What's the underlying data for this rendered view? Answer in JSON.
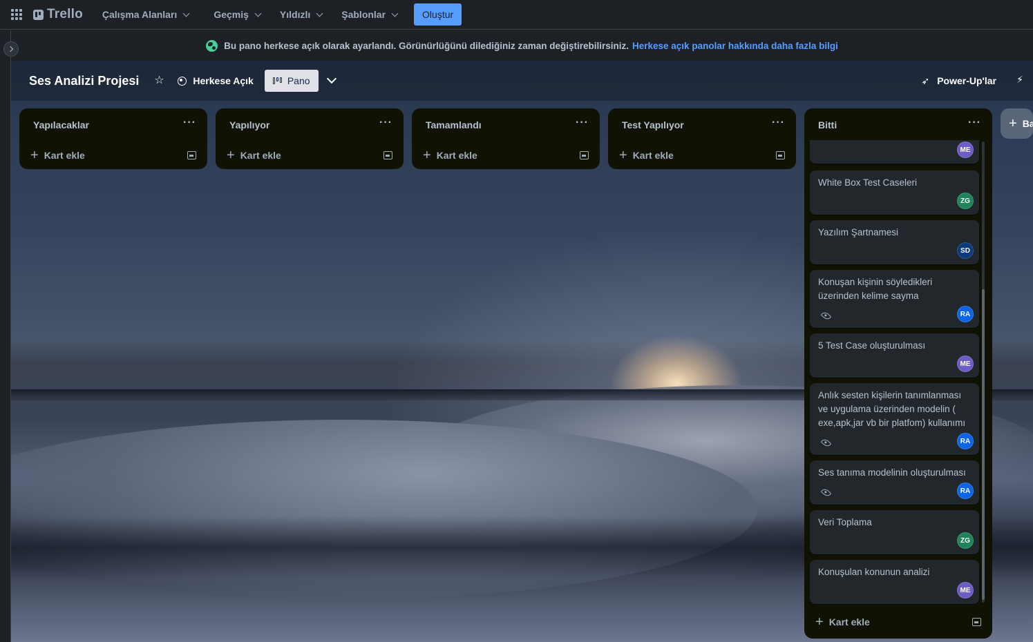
{
  "topnav": {
    "logo": "Trello",
    "items": [
      {
        "label": "Çalışma Alanları"
      },
      {
        "label": "Geçmiş"
      },
      {
        "label": "Yıldızlı"
      },
      {
        "label": "Şablonlar"
      }
    ],
    "create_label": "Oluştur"
  },
  "banner": {
    "text": "Bu pano herkese açık olarak ayarlandı. Görünürlüğünü dilediğiniz zaman değiştirebilirsiniz.",
    "link": "Herkese açık panolar hakkında daha fazla bilgi"
  },
  "board": {
    "title": "Ses Analizi Projesi",
    "visibility": "Herkese Açık",
    "view": "Pano",
    "powerups": "Power-Up'lar",
    "add_list": "Ba"
  },
  "lists": [
    {
      "title": "Yapılacaklar",
      "add_card": "Kart ekle"
    },
    {
      "title": "Yapılıyor",
      "add_card": "Kart ekle"
    },
    {
      "title": "Tamamlandı",
      "add_card": "Kart ekle"
    },
    {
      "title": "Test Yapılıyor",
      "add_card": "Kart ekle"
    },
    {
      "title": "Bitti",
      "add_card": "Kart ekle",
      "cards": [
        {
          "title": "",
          "avatar": "ME"
        },
        {
          "title": "White Box Test Caseleri",
          "avatar": "ZG"
        },
        {
          "title": "Yazılım Şartnamesi",
          "avatar": "SD"
        },
        {
          "title": "Konuşan kişinin söyledikleri üzerinden kelime sayma",
          "avatar": "RA",
          "watched": true
        },
        {
          "title": "5 Test Case oluşturulması",
          "avatar": "ME"
        },
        {
          "title": "Anlık sesten kişilerin tanımlanması ve uygulama üzerinden modelin ( exe,apk,jar vb bir platfom) kullanımı",
          "avatar": "RA",
          "watched": true
        },
        {
          "title": "Ses tanıma modelinin oluşturulması",
          "avatar": "RA",
          "watched": true
        },
        {
          "title": "Veri Toplama",
          "avatar": "ZG"
        },
        {
          "title": "Konuşulan konunun analizi",
          "avatar": "ME"
        }
      ]
    }
  ],
  "colors": {
    "avatar_ME": "#6e5dc6",
    "avatar_ZG": "#1f845a",
    "avatar_SD": "#0c3a7a",
    "avatar_RA": "#0c66e4",
    "accent": "#579dff"
  }
}
